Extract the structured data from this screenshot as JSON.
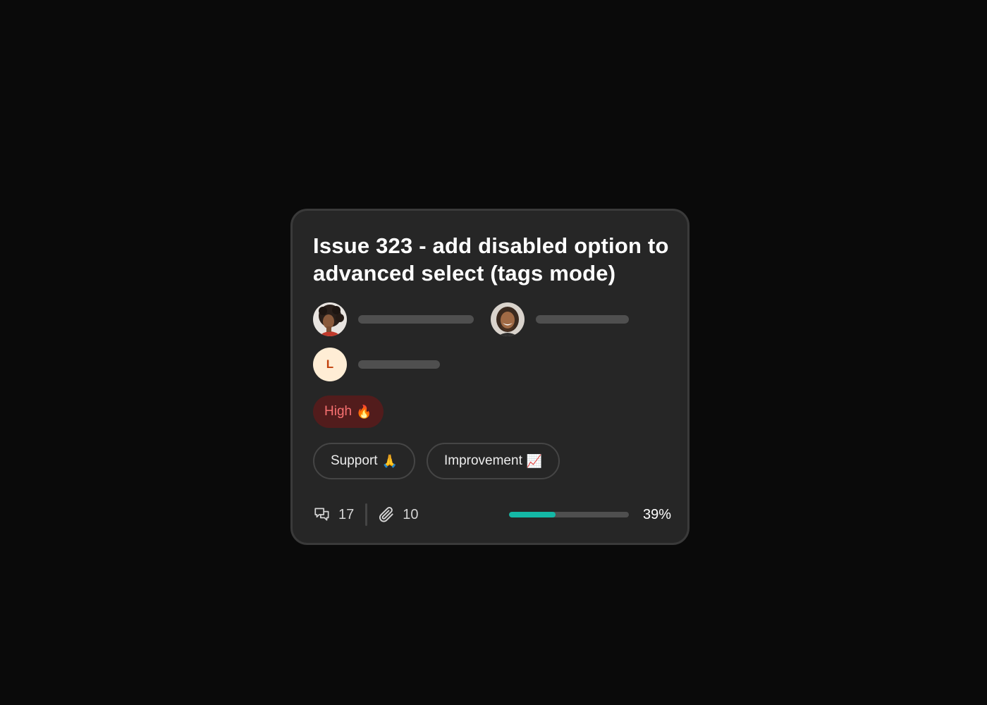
{
  "card": {
    "title": "Issue 323 - add disabled option to advanced select (tags mode)",
    "assignees": [
      {
        "avatar": "person-curly-hair-photo"
      },
      {
        "avatar": "person-dreadlocks-smiling-photo"
      },
      {
        "avatar": "initial",
        "initial": "L"
      }
    ],
    "priority": {
      "label": "High",
      "emoji": "🔥"
    },
    "tags": [
      {
        "label": "Support",
        "emoji": "🙏"
      },
      {
        "label": "Improvement",
        "emoji": "📈"
      }
    ],
    "comments": {
      "icon": "comments-icon",
      "count": "17"
    },
    "attachments": {
      "icon": "paperclip-icon",
      "count": "10"
    },
    "progress": {
      "value": 0.39,
      "label": "39%"
    }
  },
  "colors": {
    "background": "#0a0a0a",
    "card": "#262626",
    "priority_bg": "#521c1c",
    "priority_text": "#f87171",
    "progress_fill": "#14b8a6",
    "initial_avatar_bg": "#ffedd5",
    "initial_avatar_text": "#c2410c"
  }
}
